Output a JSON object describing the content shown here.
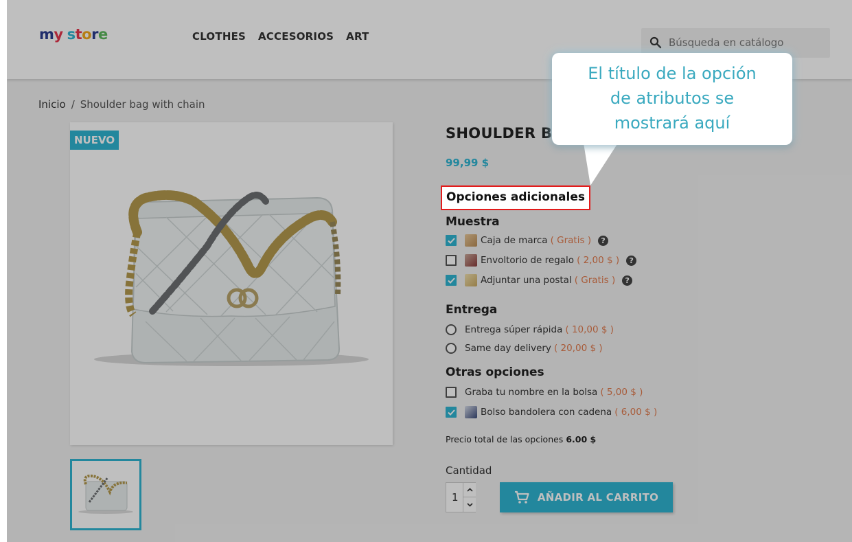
{
  "store": {
    "logo": [
      "m",
      "y",
      " ",
      "s",
      "t",
      "o",
      "r",
      "e"
    ],
    "logo_colors": [
      "#2b3d8f",
      "#e6344c",
      "",
      "#2fb5d2",
      "#e6344c",
      "#f3a81d",
      "#2b3d8f",
      "#5cb85c"
    ]
  },
  "nav": {
    "items": [
      "CLOTHES",
      "ACCESORIOS",
      "ART"
    ]
  },
  "search": {
    "placeholder": "Búsqueda en catálogo"
  },
  "breadcrumb": {
    "home": "Inicio",
    "separator": "/",
    "current": "Shoulder bag with chain"
  },
  "product": {
    "badge": "NUEVO",
    "title": "SHOULDER BAG WITH CHAIN",
    "price": "99,99 $"
  },
  "options": {
    "title": "Opciones adicionales",
    "groups": [
      {
        "name": "Muestra",
        "items": [
          {
            "label": "Caja de marca",
            "price": "Gratis",
            "checked": true,
            "help": "?"
          },
          {
            "label": "Envoltorio de regalo",
            "price": "2,00 $",
            "checked": false,
            "help": "?"
          },
          {
            "label": "Adjuntar una postal",
            "price": "Gratis",
            "checked": true,
            "help": "?"
          }
        ]
      },
      {
        "name": "Entrega",
        "items": [
          {
            "label": "Entrega súper rápida",
            "price": "10,00 $"
          },
          {
            "label": "Same day delivery",
            "price": "20,00 $"
          }
        ]
      },
      {
        "name": "Otras opciones",
        "items": [
          {
            "label": "Graba tu nombre en la bolsa",
            "price": "5,00 $",
            "checked": false
          },
          {
            "label": "Bolso bandolera con cadena",
            "price": "6,00 $",
            "checked": true
          }
        ]
      }
    ],
    "total_label": "Precio total de las opciones",
    "total_value": "6.00 $"
  },
  "cart": {
    "qty_label": "Cantidad",
    "qty_value": "1",
    "add_button": "AÑADIR AL CARRITO"
  },
  "callout": {
    "line1": "El título de la opción",
    "line2": "de atributos se",
    "line3": "mostrará aquí"
  },
  "paren_open": "(",
  "paren_close": ")",
  "colors": {
    "accent": "#2fb5d2",
    "price_option": "#e07a4d",
    "highlight_border": "#e31b1b",
    "callout_text": "#39a9bf"
  }
}
